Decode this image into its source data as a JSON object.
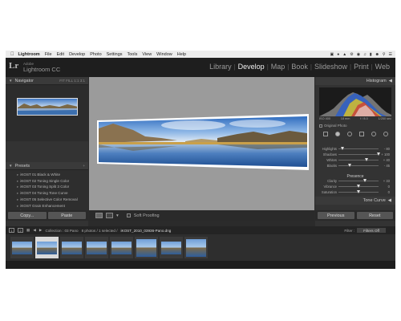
{
  "menubar": {
    "app": "Lightroom",
    "items": [
      "File",
      "Edit",
      "Develop",
      "Photo",
      "Settings",
      "Tools",
      "View",
      "Window",
      "Help"
    ]
  },
  "identity": {
    "logo": "Lr",
    "adobe": "Adobe",
    "product": "Lightroom CC"
  },
  "modules": [
    "Library",
    "Develop",
    "Map",
    "Book",
    "Slideshow",
    "Print",
    "Web"
  ],
  "active_module": "Develop",
  "left_panel": {
    "navigator_title": "Navigator",
    "navigator_controls": "FIT  FILL  1:1  3:1",
    "presets_title": "Presets",
    "presets": [
      "iKOST 01 Black & White",
      "iKOST 02 Toning Single Color",
      "iKOST 03 Toning Split 3 Color",
      "iKOST 04 Toning Tone Curve",
      "iKOST 05 Selective Color Removal",
      "iKOST Grain Enhancement",
      "iKOST Lens Correction",
      "iKOST Post-Crop Vignetting"
    ],
    "copy_label": "Copy...",
    "paste_label": "Paste"
  },
  "toolbar": {
    "soft_proofing": "Soft Proofing"
  },
  "right_panel": {
    "histogram_title": "Histogram",
    "exif": [
      "ISO 400",
      "18 mm",
      "f / 8.0",
      "1/250 sec"
    ],
    "original_photo": "Original Photo",
    "tone_sliders": [
      {
        "label": "Highlights",
        "value": "- 80",
        "pos": 0.1
      },
      {
        "label": "Shadows",
        "value": "+ 100",
        "pos": 1.0
      },
      {
        "label": "Whites",
        "value": "+ 40",
        "pos": 0.7
      },
      {
        "label": "Blacks",
        "value": "- 45",
        "pos": 0.28
      }
    ],
    "presence_title": "Presence",
    "presence_sliders": [
      {
        "label": "Clarity",
        "value": "+ 33",
        "pos": 0.66
      },
      {
        "label": "Vibrance",
        "value": "0",
        "pos": 0.5
      },
      {
        "label": "Saturation",
        "value": "0",
        "pos": 0.5
      }
    ],
    "tone_curve_title": "Tone Curve",
    "previous_label": "Previous",
    "reset_label": "Reset"
  },
  "filmstrip": {
    "page1": "1",
    "page2": "2",
    "collection": "Collection : 03 Pano",
    "count": "8 photos / 1 selected /",
    "filename": "iKOST_2010_03936-Pano.dng",
    "filter_label": "Filter :",
    "filter_value": "Filters Off",
    "thumbnails": [
      {
        "selected": false,
        "tall": false
      },
      {
        "selected": true,
        "tall": false
      },
      {
        "selected": false,
        "tall": false
      },
      {
        "selected": false,
        "tall": false
      },
      {
        "selected": false,
        "tall": false
      },
      {
        "selected": false,
        "tall": true
      },
      {
        "selected": false,
        "tall": false
      },
      {
        "selected": false,
        "tall": true
      }
    ]
  }
}
